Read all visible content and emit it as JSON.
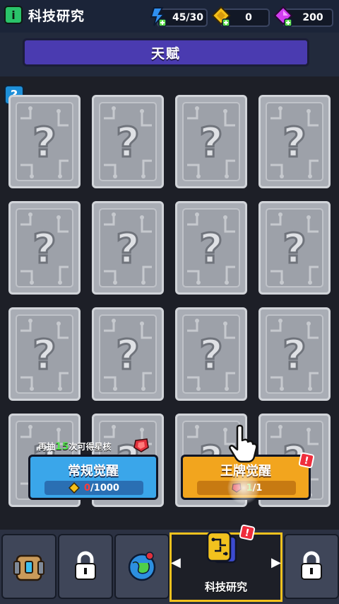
{
  "header": {
    "title": "科技研究",
    "energy": "45/30",
    "gold": "0",
    "gems": "200"
  },
  "banner": {
    "title": "天赋"
  },
  "help_badge": "?",
  "cards": {
    "count": 16,
    "state": "locked",
    "symbol": "?"
  },
  "draw_hint": {
    "prefix": "再抽",
    "count": "15",
    "suffix": "次可得星核"
  },
  "buttons": {
    "normal": {
      "label": "常规觉醒",
      "cost_current": "0",
      "cost_total": "/1000"
    },
    "ace": {
      "label": "王牌觉醒",
      "cost_current": "1",
      "cost_total": "/1",
      "alert": "!"
    }
  },
  "nav": {
    "active_label": "科技研究",
    "alert": "!",
    "left_arrow": "◀",
    "right_arrow": "▶"
  },
  "colors": {
    "accent_blue": "#3aa6ea",
    "accent_gold": "#f2a51e",
    "banner_purple": "#4a3bb0",
    "active_nav_border": "#f2c21e"
  }
}
